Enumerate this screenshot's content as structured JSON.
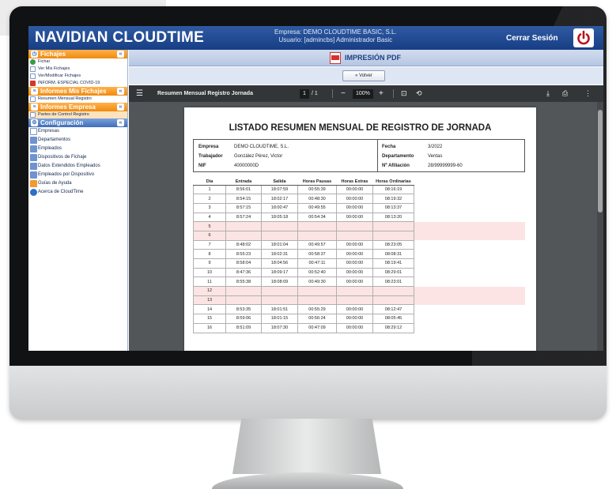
{
  "header": {
    "logo": "NAVIDIAN CLOUDTIME",
    "company_line": "Empresa: DEMO CLOUDTIME BASIC, S.L.",
    "user_line": "Usuario: [admincbs] Administrador Basic",
    "logout_label": "Cerrar Sesión"
  },
  "sidebar": {
    "sections": [
      {
        "title": "Fichajes",
        "items": [
          "Fichar",
          "Ver Mis Fichajes",
          "Ver/Modificar Fichajes",
          "INFORM. ESPECIAL COVID-19"
        ]
      },
      {
        "title": "Informes Mis Fichajes",
        "items": [
          "Resumen Mensual Registro"
        ]
      },
      {
        "title": "Informes Empresa",
        "items": [
          "Partes de Control Registro"
        ]
      },
      {
        "title": "Configuración",
        "items": [
          "Empresas",
          "Departamentos",
          "Empleados",
          "Dispositivos de Fichaje",
          "Datos Extendidos Empleados",
          "Empleados por Dispositivo",
          "Guías de Ayuda",
          "Acerca de CloudTime"
        ]
      }
    ]
  },
  "content": {
    "title": "IMPRESIÓN PDF",
    "back_label": "« Volver"
  },
  "pdf_toolbar": {
    "doc_title": "Resumen Mensual Registro Jornada",
    "page_current": "1",
    "page_total": "/ 1",
    "zoom": "100%"
  },
  "document": {
    "heading": "LISTADO RESUMEN MENSUAL DE REGISTRO DE JORNADA",
    "labels": {
      "empresa": "Empresa",
      "trabajador": "Trabajador",
      "nif": "NIF",
      "fecha": "Fecha",
      "departamento": "Departamento",
      "afiliacion": "Nº Afiliación"
    },
    "values": {
      "empresa": "DEMO CLOUDTIME, S.L.",
      "trabajador": "González Pérez, Victor",
      "nif": "40000000D",
      "fecha": "3/2022",
      "departamento": "Ventas",
      "afiliacion": "28/99999999-60"
    },
    "table": {
      "columns": [
        "Día",
        "Entrada",
        "Salida",
        "Horas Pausas",
        "Horas Extras",
        "Horas Ordinarias"
      ],
      "rows": [
        [
          "1",
          "8:56:01",
          "18:07:59",
          "00:55:39",
          "00:00:00",
          "08:16:19"
        ],
        [
          "2",
          "8:54:15",
          "18:02:17",
          "00:48:30",
          "00:00:00",
          "08:19:32"
        ],
        [
          "3",
          "8:57:15",
          "18:00:47",
          "00:49:55",
          "00:00:00",
          "08:13:37"
        ],
        [
          "4",
          "8:57:24",
          "18:05:18",
          "00:54:34",
          "00:00:00",
          "08:13:20"
        ],
        [
          "5",
          "",
          "",
          "",
          "",
          ""
        ],
        [
          "6",
          "",
          "",
          "",
          "",
          ""
        ],
        [
          "7",
          "8:48:02",
          "18:01:04",
          "00:49:57",
          "00:00:00",
          "08:23:05"
        ],
        [
          "8",
          "8:55:23",
          "18:02:31",
          "00:58:37",
          "00:00:00",
          "08:08:31"
        ],
        [
          "9",
          "8:58:04",
          "18:04:56",
          "00:47:11",
          "00:00:00",
          "08:19:41"
        ],
        [
          "10",
          "8:47:36",
          "18:09:17",
          "00:52:40",
          "00:00:00",
          "08:29:01"
        ],
        [
          "11",
          "8:55:38",
          "18:08:09",
          "00:49:30",
          "00:00:00",
          "08:23:01"
        ],
        [
          "12",
          "",
          "",
          "",
          "",
          ""
        ],
        [
          "13",
          "",
          "",
          "",
          "",
          ""
        ],
        [
          "14",
          "8:53:35",
          "18:01:51",
          "00:55:29",
          "00:00:00",
          "08:12:47"
        ],
        [
          "15",
          "8:59:06",
          "18:01:15",
          "00:56:24",
          "00:00:00",
          "08:05:45"
        ],
        [
          "16",
          "8:51:09",
          "18:07:30",
          "00:47:09",
          "00:00:00",
          "08:29:12"
        ]
      ]
    }
  },
  "colors": {
    "header_blue": "#1f4a96",
    "sidebar_orange": "#f08a10",
    "empty_row_pink": "#fde4e4",
    "pdf_toolbar": "#323639",
    "logout_red": "#b4161b"
  }
}
